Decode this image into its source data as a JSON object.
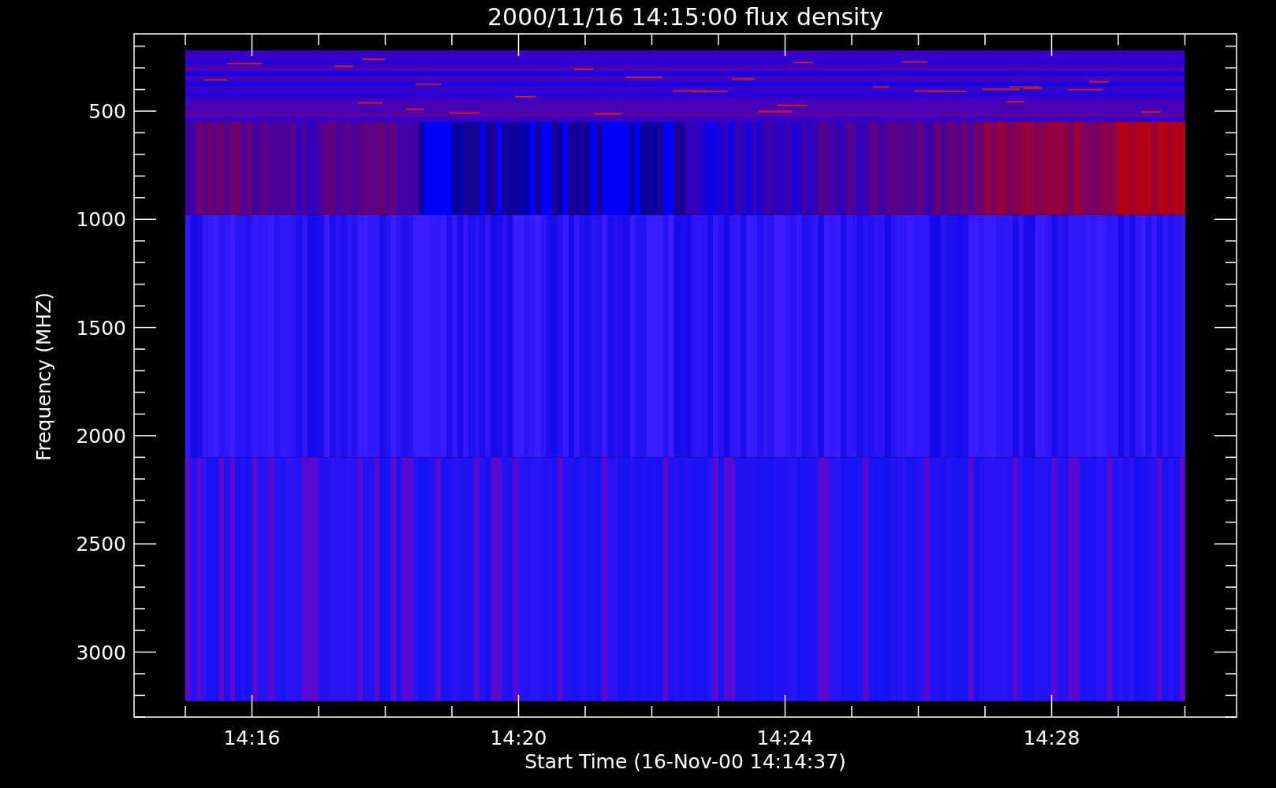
{
  "title": "2000/11/16 14:15:00 flux density",
  "y_axis": {
    "label": "Frequency (MHZ)",
    "ticks": [
      "500",
      "1000",
      "1500",
      "2000",
      "2500",
      "3000"
    ]
  },
  "x_axis": {
    "label": "Start Time (16-Nov-00 14:14:37)",
    "ticks": [
      "14:16",
      "14:20",
      "14:24",
      "14:28"
    ]
  }
}
